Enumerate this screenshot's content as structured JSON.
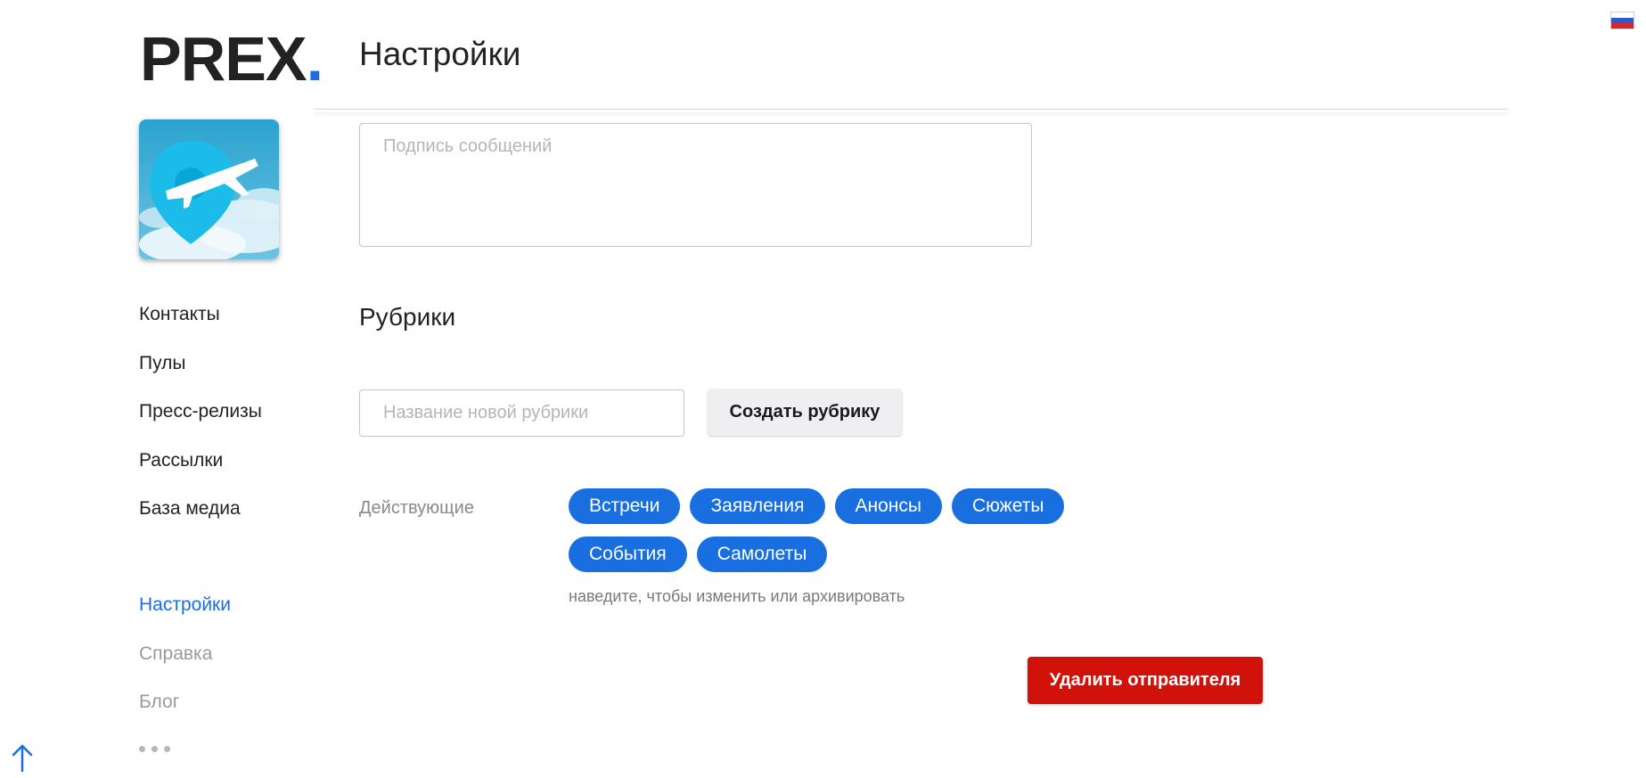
{
  "logo": {
    "text": "PREX",
    "dot": "."
  },
  "avatar": {
    "icon": "plane-location-pin-icon"
  },
  "sidebar": {
    "items": [
      {
        "label": "Контакты"
      },
      {
        "label": "Пулы"
      },
      {
        "label": "Пресс-релизы"
      },
      {
        "label": "Рассылки"
      },
      {
        "label": "База медиа"
      }
    ],
    "secondary": [
      {
        "label": "Настройки",
        "active": true
      },
      {
        "label": "Справка"
      },
      {
        "label": "Блог"
      }
    ],
    "more_icon": "more-dots-icon",
    "scroll_top_icon": "arrow-up-icon"
  },
  "language": {
    "icon": "russian-flag-icon"
  },
  "header": {
    "title": "Настройки"
  },
  "signature": {
    "placeholder": "Подпись сообщений",
    "value": ""
  },
  "categories": {
    "heading": "Рубрики",
    "new_placeholder": "Название новой рубрики",
    "create_label": "Создать рубрику",
    "active_label": "Действующие",
    "tags": [
      "Встречи",
      "Заявления",
      "Анонсы",
      "Сюжеты",
      "События",
      "Самолеты"
    ],
    "hint": "наведите, чтобы изменить или архивировать"
  },
  "actions": {
    "delete_sender_label": "Удалить отправителя"
  },
  "colors": {
    "accent": "#1a6fe0",
    "danger": "#d0120a",
    "button_gray": "#efeff1",
    "muted_text": "#9a9a9a"
  }
}
